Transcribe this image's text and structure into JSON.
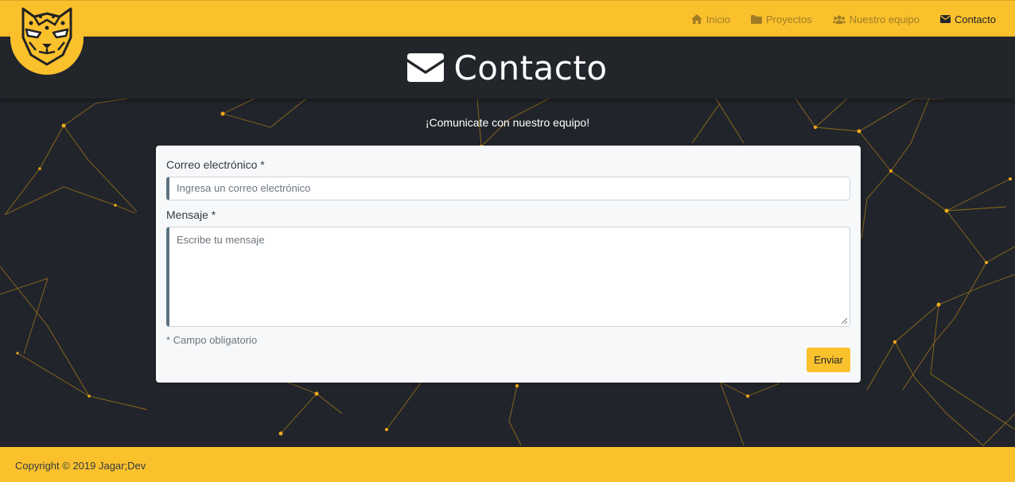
{
  "nav": {
    "items": [
      {
        "label": "Inicio",
        "icon": "home-icon"
      },
      {
        "label": "Proyectos",
        "icon": "folder-icon"
      },
      {
        "label": "Nuestro equipo",
        "icon": "users-icon"
      },
      {
        "label": "Contacto",
        "icon": "envelope-icon",
        "active": true
      }
    ]
  },
  "header": {
    "title": "Contacto",
    "icon": "envelope-icon"
  },
  "subtitle": "¡Comunicate con nuestro equipo!",
  "form": {
    "email_label": "Correo electrónico *",
    "email_placeholder": "Ingresa un correo electrónico",
    "email_value": "",
    "message_label": "Mensaje *",
    "message_placeholder": "Escribe tu mensaje",
    "message_value": "",
    "required_note": "* Campo obligatorio",
    "submit_label": "Enviar"
  },
  "footer": {
    "copyright": "Copyright © 2019 Jagar;Dev"
  },
  "colors": {
    "accent": "#fbc12d",
    "background": "#21252b",
    "network_lines": "#b3821a"
  }
}
